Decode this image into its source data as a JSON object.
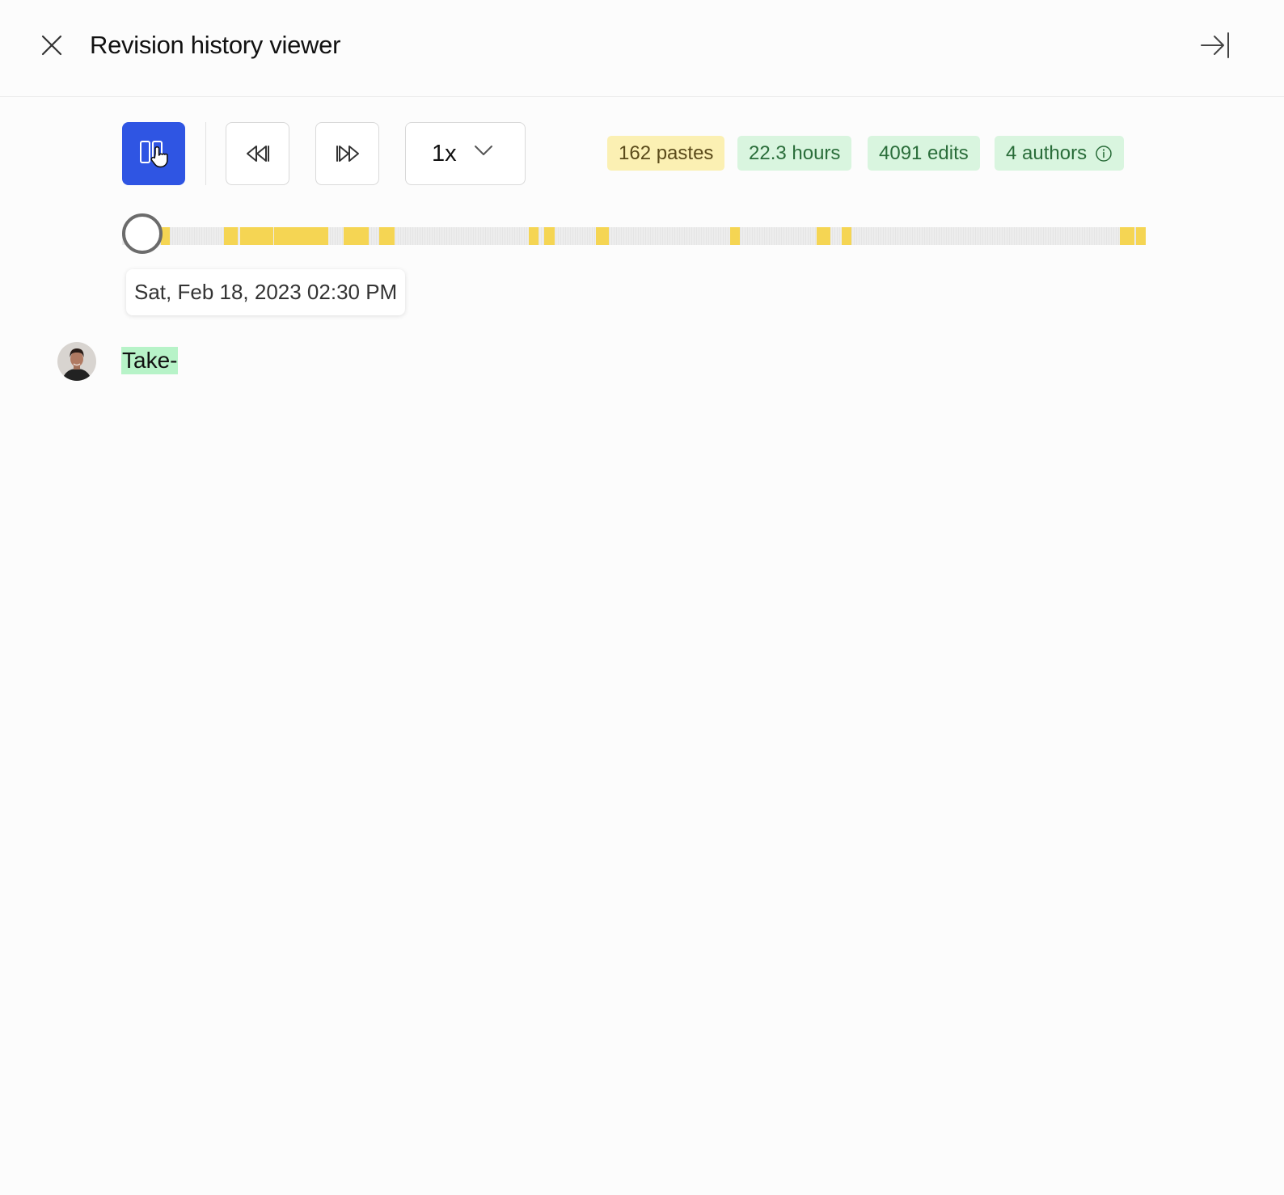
{
  "header": {
    "title": "Revision history viewer"
  },
  "toolbar": {
    "playback_state": "playing",
    "speed": "1x",
    "stats": {
      "pastes": "162 pastes",
      "hours": "22.3 hours",
      "edits": "4091 edits",
      "authors": "4 authors"
    }
  },
  "timeline": {
    "position": 0,
    "timestamp": "Sat, Feb 18, 2023 02:30 PM",
    "paste_marker_color": "#f5d553"
  },
  "document": {
    "text": "Take-",
    "highlight_color": "#b7f3c8"
  },
  "colors": {
    "accent": "#2f55e3",
    "paste_badge_bg": "#fbf0b3",
    "stat_badge_bg": "#d9f5df"
  },
  "icons": {
    "close": "close-icon",
    "collapse": "collapse-right-icon",
    "pause": "pause-icon",
    "cursor": "hand-pointer-icon",
    "rewind": "rewind-icon",
    "forward": "fast-forward-icon",
    "chevron": "chevron-down-icon",
    "info": "info-icon"
  }
}
